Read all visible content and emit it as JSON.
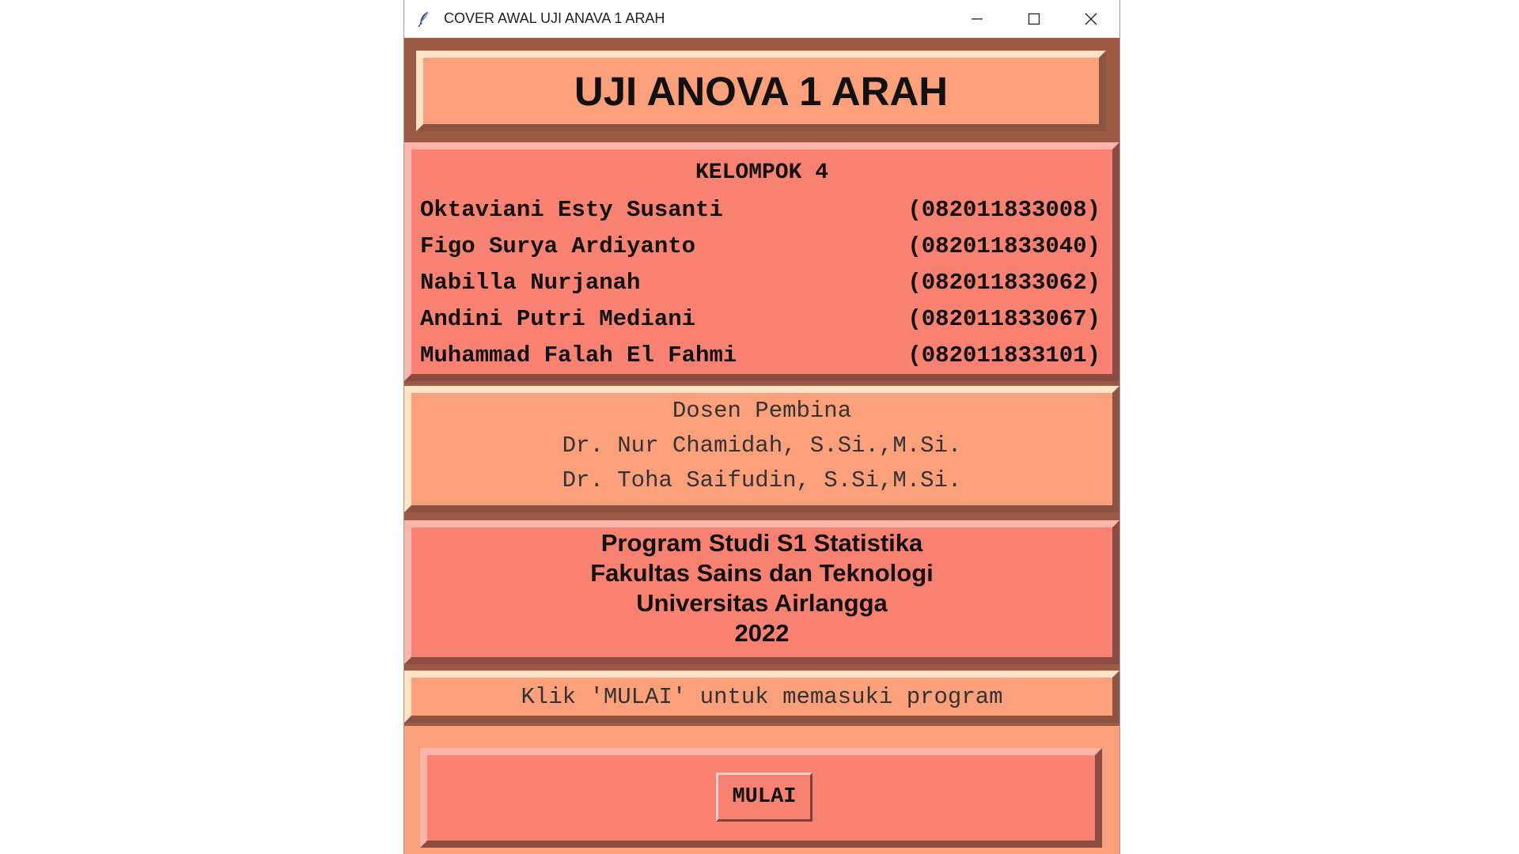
{
  "window": {
    "title": "COVER AWAL UJI ANAVA 1 ARAH",
    "app_icon": "feather-icon",
    "controls": [
      "minimize-icon",
      "maximize-icon",
      "close-icon"
    ]
  },
  "header": {
    "title": "UJI ANOVA 1 ARAH"
  },
  "group": {
    "title": "KELOMPOK 4",
    "members": [
      {
        "name": "Oktaviani Esty Susanti",
        "nim": "(082011833008)"
      },
      {
        "name": "Figo Surya Ardiyanto",
        "nim": "(082011833040)"
      },
      {
        "name": "Nabilla Nurjanah",
        "nim": "(082011833062)"
      },
      {
        "name": "Andini Putri Mediani",
        "nim": "(082011833067)"
      },
      {
        "name": "Muhammad Falah El Fahmi",
        "nim": "(082011833101)"
      }
    ]
  },
  "advisors": {
    "title": "Dosen Pembina",
    "names": [
      "Dr. Nur Chamidah, S.Si.,M.Si.",
      "Dr. Toha Saifudin, S.Si,M.Si."
    ]
  },
  "institution": {
    "lines": [
      "Program Studi S1 Statistika",
      "Fakultas Sains dan Teknologi",
      "Universitas Airlangga",
      "2022"
    ]
  },
  "instruction": {
    "text": "Klik 'MULAI' untuk memasuki program"
  },
  "start_button": {
    "label": "MULAI"
  },
  "colors": {
    "frame_dark": "#9c5a44",
    "salmon": "#f88171",
    "peach": "#fba07a"
  }
}
